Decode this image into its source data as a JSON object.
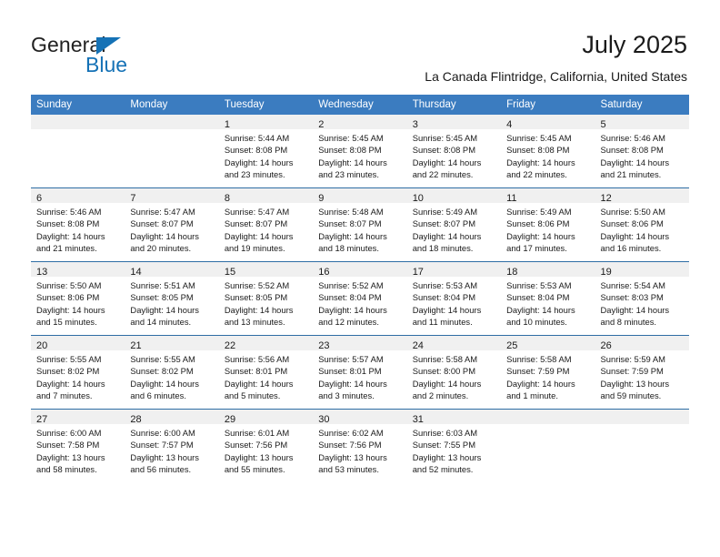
{
  "brand": {
    "name_part1": "General",
    "name_part2": "Blue",
    "triangle_color": "#1572b6",
    "text_color": "#222222"
  },
  "header": {
    "title": "July 2025",
    "subtitle": "La Canada Flintridge, California, United States"
  },
  "theme": {
    "header_bar": "#3b7cc0",
    "row_divider": "#2e6da4",
    "daynum_band": "#f0f0f0",
    "page_bg": "#ffffff"
  },
  "weekdays": [
    "Sunday",
    "Monday",
    "Tuesday",
    "Wednesday",
    "Thursday",
    "Friday",
    "Saturday"
  ],
  "weeks": [
    [
      {
        "day": "",
        "lines": []
      },
      {
        "day": "",
        "lines": []
      },
      {
        "day": "1",
        "lines": [
          "Sunrise: 5:44 AM",
          "Sunset: 8:08 PM",
          "Daylight: 14 hours",
          "and 23 minutes."
        ]
      },
      {
        "day": "2",
        "lines": [
          "Sunrise: 5:45 AM",
          "Sunset: 8:08 PM",
          "Daylight: 14 hours",
          "and 23 minutes."
        ]
      },
      {
        "day": "3",
        "lines": [
          "Sunrise: 5:45 AM",
          "Sunset: 8:08 PM",
          "Daylight: 14 hours",
          "and 22 minutes."
        ]
      },
      {
        "day": "4",
        "lines": [
          "Sunrise: 5:45 AM",
          "Sunset: 8:08 PM",
          "Daylight: 14 hours",
          "and 22 minutes."
        ]
      },
      {
        "day": "5",
        "lines": [
          "Sunrise: 5:46 AM",
          "Sunset: 8:08 PM",
          "Daylight: 14 hours",
          "and 21 minutes."
        ]
      }
    ],
    [
      {
        "day": "6",
        "lines": [
          "Sunrise: 5:46 AM",
          "Sunset: 8:08 PM",
          "Daylight: 14 hours",
          "and 21 minutes."
        ]
      },
      {
        "day": "7",
        "lines": [
          "Sunrise: 5:47 AM",
          "Sunset: 8:07 PM",
          "Daylight: 14 hours",
          "and 20 minutes."
        ]
      },
      {
        "day": "8",
        "lines": [
          "Sunrise: 5:47 AM",
          "Sunset: 8:07 PM",
          "Daylight: 14 hours",
          "and 19 minutes."
        ]
      },
      {
        "day": "9",
        "lines": [
          "Sunrise: 5:48 AM",
          "Sunset: 8:07 PM",
          "Daylight: 14 hours",
          "and 18 minutes."
        ]
      },
      {
        "day": "10",
        "lines": [
          "Sunrise: 5:49 AM",
          "Sunset: 8:07 PM",
          "Daylight: 14 hours",
          "and 18 minutes."
        ]
      },
      {
        "day": "11",
        "lines": [
          "Sunrise: 5:49 AM",
          "Sunset: 8:06 PM",
          "Daylight: 14 hours",
          "and 17 minutes."
        ]
      },
      {
        "day": "12",
        "lines": [
          "Sunrise: 5:50 AM",
          "Sunset: 8:06 PM",
          "Daylight: 14 hours",
          "and 16 minutes."
        ]
      }
    ],
    [
      {
        "day": "13",
        "lines": [
          "Sunrise: 5:50 AM",
          "Sunset: 8:06 PM",
          "Daylight: 14 hours",
          "and 15 minutes."
        ]
      },
      {
        "day": "14",
        "lines": [
          "Sunrise: 5:51 AM",
          "Sunset: 8:05 PM",
          "Daylight: 14 hours",
          "and 14 minutes."
        ]
      },
      {
        "day": "15",
        "lines": [
          "Sunrise: 5:52 AM",
          "Sunset: 8:05 PM",
          "Daylight: 14 hours",
          "and 13 minutes."
        ]
      },
      {
        "day": "16",
        "lines": [
          "Sunrise: 5:52 AM",
          "Sunset: 8:04 PM",
          "Daylight: 14 hours",
          "and 12 minutes."
        ]
      },
      {
        "day": "17",
        "lines": [
          "Sunrise: 5:53 AM",
          "Sunset: 8:04 PM",
          "Daylight: 14 hours",
          "and 11 minutes."
        ]
      },
      {
        "day": "18",
        "lines": [
          "Sunrise: 5:53 AM",
          "Sunset: 8:04 PM",
          "Daylight: 14 hours",
          "and 10 minutes."
        ]
      },
      {
        "day": "19",
        "lines": [
          "Sunrise: 5:54 AM",
          "Sunset: 8:03 PM",
          "Daylight: 14 hours",
          "and 8 minutes."
        ]
      }
    ],
    [
      {
        "day": "20",
        "lines": [
          "Sunrise: 5:55 AM",
          "Sunset: 8:02 PM",
          "Daylight: 14 hours",
          "and 7 minutes."
        ]
      },
      {
        "day": "21",
        "lines": [
          "Sunrise: 5:55 AM",
          "Sunset: 8:02 PM",
          "Daylight: 14 hours",
          "and 6 minutes."
        ]
      },
      {
        "day": "22",
        "lines": [
          "Sunrise: 5:56 AM",
          "Sunset: 8:01 PM",
          "Daylight: 14 hours",
          "and 5 minutes."
        ]
      },
      {
        "day": "23",
        "lines": [
          "Sunrise: 5:57 AM",
          "Sunset: 8:01 PM",
          "Daylight: 14 hours",
          "and 3 minutes."
        ]
      },
      {
        "day": "24",
        "lines": [
          "Sunrise: 5:58 AM",
          "Sunset: 8:00 PM",
          "Daylight: 14 hours",
          "and 2 minutes."
        ]
      },
      {
        "day": "25",
        "lines": [
          "Sunrise: 5:58 AM",
          "Sunset: 7:59 PM",
          "Daylight: 14 hours",
          "and 1 minute."
        ]
      },
      {
        "day": "26",
        "lines": [
          "Sunrise: 5:59 AM",
          "Sunset: 7:59 PM",
          "Daylight: 13 hours",
          "and 59 minutes."
        ]
      }
    ],
    [
      {
        "day": "27",
        "lines": [
          "Sunrise: 6:00 AM",
          "Sunset: 7:58 PM",
          "Daylight: 13 hours",
          "and 58 minutes."
        ]
      },
      {
        "day": "28",
        "lines": [
          "Sunrise: 6:00 AM",
          "Sunset: 7:57 PM",
          "Daylight: 13 hours",
          "and 56 minutes."
        ]
      },
      {
        "day": "29",
        "lines": [
          "Sunrise: 6:01 AM",
          "Sunset: 7:56 PM",
          "Daylight: 13 hours",
          "and 55 minutes."
        ]
      },
      {
        "day": "30",
        "lines": [
          "Sunrise: 6:02 AM",
          "Sunset: 7:56 PM",
          "Daylight: 13 hours",
          "and 53 minutes."
        ]
      },
      {
        "day": "31",
        "lines": [
          "Sunrise: 6:03 AM",
          "Sunset: 7:55 PM",
          "Daylight: 13 hours",
          "and 52 minutes."
        ]
      },
      {
        "day": "",
        "lines": []
      },
      {
        "day": "",
        "lines": []
      }
    ]
  ]
}
